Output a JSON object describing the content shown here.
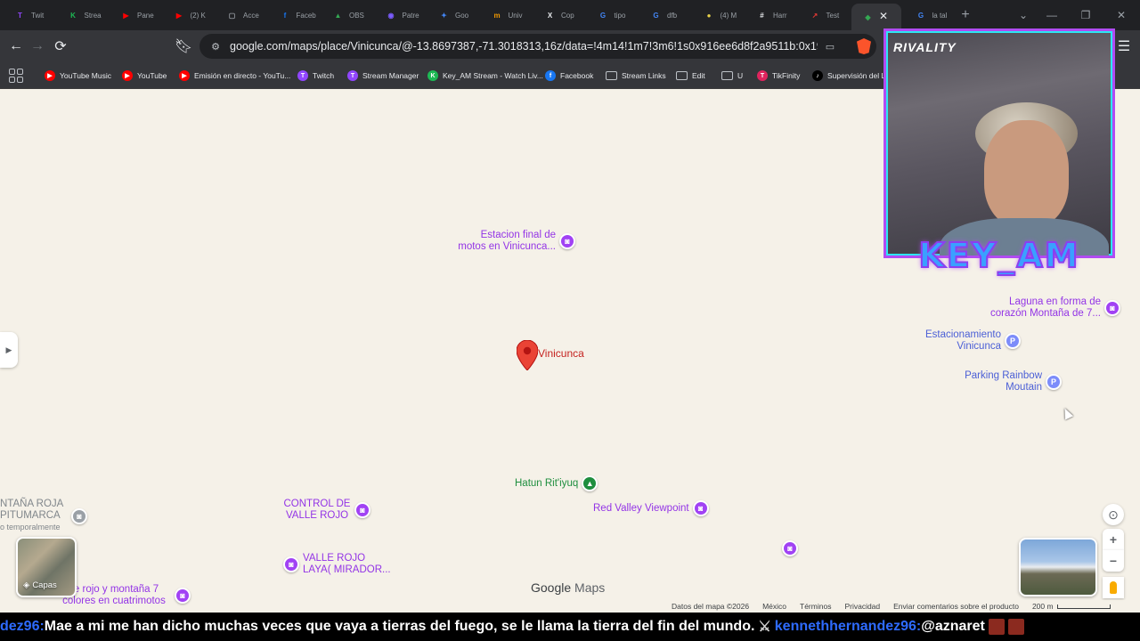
{
  "tabs": [
    {
      "label": "Twit",
      "color": "#9146ff",
      "glyph": "T"
    },
    {
      "label": "Strea",
      "color": "#1db954",
      "glyph": "K"
    },
    {
      "label": "Pane",
      "color": "#ff0000",
      "glyph": "▶"
    },
    {
      "label": "(2) K",
      "color": "#ff0000",
      "glyph": "▶"
    },
    {
      "label": "Acce",
      "color": "#9aa0a6",
      "glyph": "▢"
    },
    {
      "label": "Faceb",
      "color": "#1877f2",
      "glyph": "f"
    },
    {
      "label": "OBS",
      "color": "#34a853",
      "glyph": "▲"
    },
    {
      "label": "Patre",
      "color": "#7b5cff",
      "glyph": "◉"
    },
    {
      "label": "Goo",
      "color": "#4285f4",
      "glyph": "✦"
    },
    {
      "label": "Univ",
      "color": "#f29900",
      "glyph": "m"
    },
    {
      "label": "Cop",
      "color": "#e8eaed",
      "glyph": "X"
    },
    {
      "label": "tipo",
      "color": "#4285f4",
      "glyph": "G"
    },
    {
      "label": "dfb",
      "color": "#4285f4",
      "glyph": "G"
    },
    {
      "label": "(4) M",
      "color": "#e8d14a",
      "glyph": "●"
    },
    {
      "label": "Harr",
      "color": "#e8eaed",
      "glyph": "#"
    },
    {
      "label": "Test",
      "color": "#e53935",
      "glyph": "↗"
    },
    {
      "label": "",
      "color": "#34a853",
      "glyph": "◆"
    },
    {
      "label": "la tal",
      "color": "#4285f4",
      "glyph": "G"
    }
  ],
  "url": "google.com/maps/place/Vinicunca/@-13.8697387,-71.3018313,16z/data=!4m14!1m7!3m6!1s0x916ee6d8f2a9511b:0x199...",
  "bookmarks": [
    {
      "label": "YouTube Music",
      "color": "#ff0000",
      "glyph": "▶"
    },
    {
      "label": "YouTube",
      "color": "#ff0000",
      "glyph": "▶"
    },
    {
      "label": "Emisión en directo - YouTu...",
      "color": "#ff0000",
      "glyph": "▶"
    },
    {
      "label": "Twitch",
      "color": "#9146ff",
      "glyph": "T"
    },
    {
      "label": "Stream Manager",
      "color": "#9146ff",
      "glyph": "T"
    },
    {
      "label": "Key_AM Stream - Watch Liv...",
      "color": "#1db954",
      "glyph": "K"
    },
    {
      "label": "Facebook",
      "color": "#1877f2",
      "glyph": "f"
    },
    {
      "label": "Stream Links",
      "folder": true
    },
    {
      "label": "Edit",
      "folder": true
    },
    {
      "label": "U",
      "folder": true
    },
    {
      "label": "TikFinity",
      "color": "#e0245e",
      "glyph": "T"
    },
    {
      "label": "Supervisión del LI",
      "color": "#000000",
      "glyph": "♪"
    }
  ],
  "map": {
    "pin_label": "Vinicunca",
    "pois": {
      "estacion": "Estacion final de motos en Vinicunca...",
      "laguna": "Laguna en forma de corazón Montaña de 7...",
      "estacionamiento": "Estacionamiento Vinicunca",
      "parking": "Parking Rainbow Moutain",
      "hatun": "Hatun Rit'iyuq",
      "red_valley": "Red Valley Viewpoint",
      "control": "CONTROL DE VALLE ROJO",
      "valle_rojo": "VALLE ROJO LAYA( MIRADOR...",
      "montana_roja": "NTAÑA ROJA PITUMARCA",
      "montana_roja_sub": "o temporalmente",
      "valle_7": "lle rojo y montaña 7 colores en cuatrimotos"
    },
    "layers_label": "Capas",
    "logo_google": "Google",
    "logo_maps": "Maps",
    "footer": [
      "Datos del mapa ©2026",
      "México",
      "Términos",
      "Privacidad",
      "Enviar comentarios sobre el producto"
    ],
    "scale_label": "200 m"
  },
  "stream": {
    "brand": "RIVALITY",
    "name": "KEY_AM"
  },
  "ticker": {
    "user1": "dez96:",
    "message": " Mae a mi me han dicho muchas veces que vaya a tierras del fuego, se le llama la tierra del fin del mundo. ",
    "user2": "kennethhernandez96:",
    "mention": " @aznaret"
  },
  "colors": {
    "map_bg": "#f5f1e8",
    "poi_purple": "#a142f4",
    "pin_red": "#ea4335",
    "overlay_purple": "#b14bf2",
    "overlay_cyan": "#2de6f2"
  }
}
